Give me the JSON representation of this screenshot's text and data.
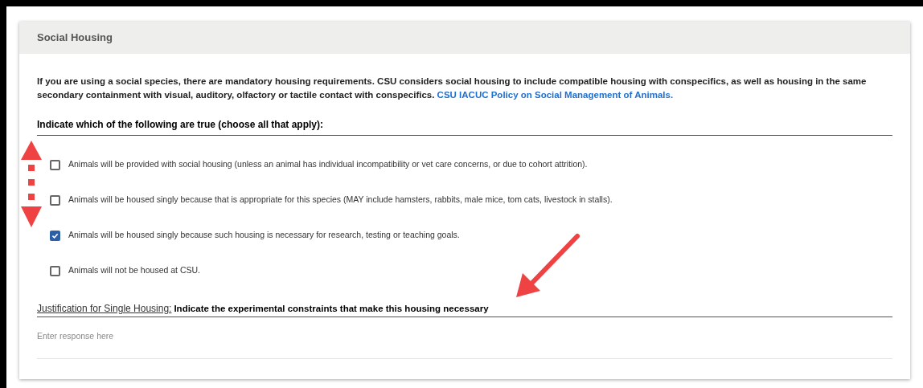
{
  "section": {
    "title": "Social Housing"
  },
  "intro": {
    "text": "If you are using a social species, there are mandatory housing requirements. CSU considers social housing to include compatible housing with conspecifics, as well as housing in the same secondary containment with visual, auditory, olfactory or tactile contact with conspecifics.",
    "link": "CSU IACUC Policy on Social Management of Animals."
  },
  "question": "Indicate which of the following are true (choose all that apply):",
  "options": [
    {
      "label": "Animals will be provided with social housing (unless an animal has individual incompatibility or vet care concerns, or due to cohort attrition).",
      "checked": false
    },
    {
      "label": "Animals will be housed singly because that is appropriate for this species (MAY include hamsters, rabbits, male mice, tom cats, livestock in stalls).",
      "checked": false
    },
    {
      "label": "Animals will be housed singly because such housing is necessary for research, testing or teaching goals.",
      "checked": true
    },
    {
      "label": "Animals will not be housed at CSU.",
      "checked": false
    }
  ],
  "justification": {
    "label": "Justification for Single Housing:",
    "prompt": "Indicate the experimental constraints that make this housing necessary",
    "placeholder": "Enter response here"
  }
}
